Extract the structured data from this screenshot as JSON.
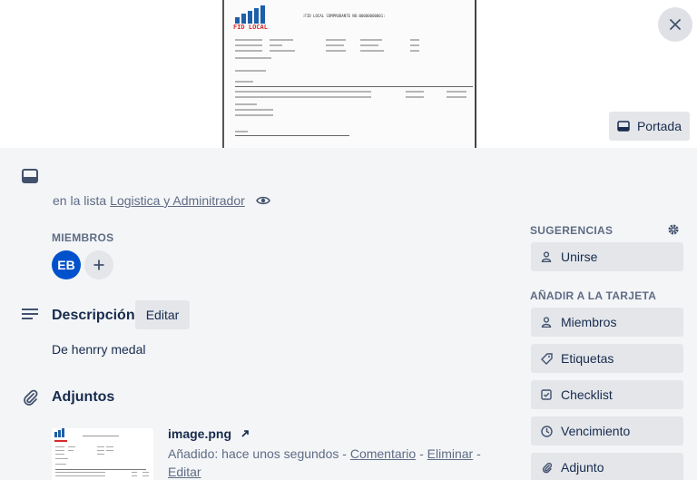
{
  "cover": {
    "button_label": "Portada",
    "document": {
      "logo_text": "FID LOCAL",
      "header": ":FID LOCAL COMPROBANTE NO:00000000001:"
    }
  },
  "card": {
    "list_prefix": "en la lista",
    "list_name": "Logistica y Adminitrador"
  },
  "members": {
    "title": "MIEMBROS",
    "avatar_initials": "EB"
  },
  "description": {
    "title": "Descripción",
    "edit_label": "Editar",
    "text": "De henrry medal"
  },
  "attachments": {
    "title": "Adjuntos",
    "items": [
      {
        "name": "image.png",
        "added": "Añadido: hace unos segundos",
        "comment": "Comentario",
        "delete": "Eliminar",
        "edit": "Editar"
      }
    ]
  },
  "sidebar": {
    "suggestions_title": "SUGERENCIAS",
    "join_label": "Unirse",
    "add_title": "AÑADIR A LA TARJETA",
    "buttons": [
      {
        "label": "Miembros",
        "icon": "person-icon"
      },
      {
        "label": "Etiquetas",
        "icon": "tag-icon"
      },
      {
        "label": "Checklist",
        "icon": "checklist-icon"
      },
      {
        "label": "Vencimiento",
        "icon": "clock-icon"
      },
      {
        "label": "Adjunto",
        "icon": "paperclip-icon"
      }
    ]
  },
  "colors": {
    "avatar": "#0052cc",
    "background": "#f4f5f7",
    "button": "#e4e6ea",
    "logo_red": "#d62b2b"
  }
}
